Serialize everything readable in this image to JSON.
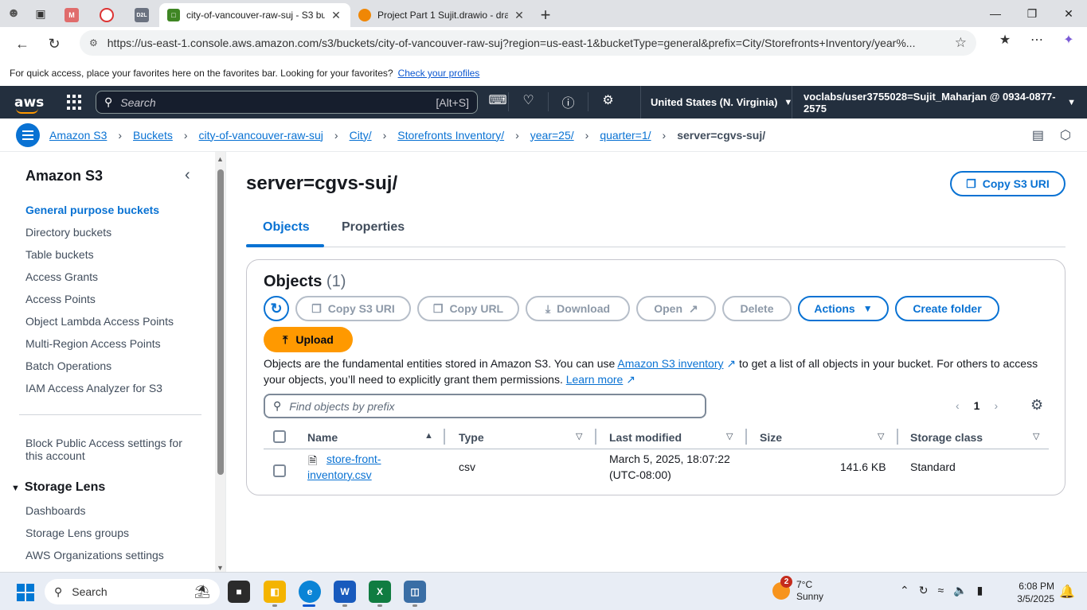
{
  "browser": {
    "tabs": [
      {
        "title": "city-of-vancouver-raw-suj - S3 bu",
        "active": true
      },
      {
        "title": "Project Part 1 Sujit.drawio - draw.i",
        "active": false
      }
    ],
    "pinned": [
      "M",
      "D2L"
    ],
    "url": "https://us-east-1.console.aws.amazon.com/s3/buckets/city-of-vancouver-raw-suj?region=us-east-1&bucketType=general&prefix=City/Storefronts+Inventory/year%...",
    "favorites_text": "For quick access, place your favorites here on the favorites bar. Looking for your favorites?",
    "favorites_link": "Check your profiles"
  },
  "aws": {
    "logo": "aws",
    "search_placeholder": "Search",
    "search_shortcut": "[Alt+S]",
    "region": "United States (N. Virginia)",
    "account": "voclabs/user3755028=Sujit_Maharjan @ 0934-0877-2575"
  },
  "breadcrumbs": [
    "Amazon S3",
    "Buckets",
    "city-of-vancouver-raw-suj",
    "City/",
    "Storefronts Inventory/",
    "year=25/",
    "quarter=1/"
  ],
  "breadcrumb_current": "server=cgvs-suj/",
  "sidenav": {
    "title": "Amazon S3",
    "items": [
      "General purpose buckets",
      "Directory buckets",
      "Table buckets",
      "Access Grants",
      "Access Points",
      "Object Lambda Access Points",
      "Multi-Region Access Points",
      "Batch Operations",
      "IAM Access Analyzer for S3"
    ],
    "block_public_1": "Block Public Access settings for",
    "block_public_2": "this account",
    "storage_lens_title": "Storage Lens",
    "storage_lens_items": [
      "Dashboards",
      "Storage Lens groups",
      "AWS Organizations settings"
    ]
  },
  "main": {
    "title": "server=cgvs-suj/",
    "copy_s3_uri_top": "Copy S3 URI",
    "tabs": [
      "Objects",
      "Properties"
    ],
    "objects_title": "Objects",
    "objects_count": "(1)",
    "toolbar": {
      "copy_s3_uri": "Copy S3 URI",
      "copy_url": "Copy URL",
      "download": "Download",
      "open": "Open",
      "delete": "Delete",
      "actions": "Actions",
      "create_folder": "Create folder",
      "upload": "Upload"
    },
    "desc_1": "Objects are the fundamental entities stored in Amazon S3. You can use",
    "desc_link": "Amazon S3 inventory",
    "desc_2": "to get a list of all objects in your bucket. For others to access your objects, you’ll need to explicitly grant them permissions.",
    "learn_more": "Learn more",
    "find_placeholder": "Find objects by prefix",
    "page": "1",
    "columns": [
      "Name",
      "Type",
      "Last modified",
      "Size",
      "Storage class"
    ],
    "rows": [
      {
        "name_1": "store-front-",
        "name_2": "inventory.csv",
        "type": "csv",
        "modified_1": "March 5, 2025, 18:07:22",
        "modified_2": "(UTC-08:00)",
        "size": "141.6 KB",
        "storage_class": "Standard"
      }
    ]
  },
  "taskbar": {
    "search_placeholder": "Search",
    "weather_badge": "2",
    "temp": "7°C",
    "condition": "Sunny",
    "time": "6:08 PM",
    "date": "3/5/2025"
  }
}
